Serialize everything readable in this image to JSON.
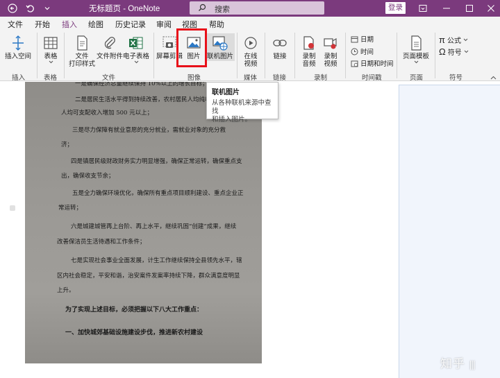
{
  "titlebar": {
    "title": "无标题页  -  OneNote",
    "search_placeholder": "搜索",
    "login": "登录",
    "icons": [
      "back-arrow-icon",
      "undo-icon",
      "dropdown-icon",
      "search-icon",
      "ribbon-display-icon",
      "minimize-icon",
      "maximize-icon",
      "close-icon"
    ]
  },
  "menu": {
    "tabs": [
      "文件",
      "开始",
      "插入",
      "绘图",
      "历史记录",
      "审阅",
      "视图",
      "帮助"
    ],
    "active": "插入"
  },
  "ribbon": {
    "insert_space": "插入空间",
    "table": "表格",
    "file_printout_1": "文件",
    "file_printout_2": "打印样式",
    "file_attachment": "文件附件",
    "spreadsheet": "电子表格",
    "screen_clipping": "屏幕剪辑",
    "picture": "图片",
    "online_picture": "联机图片",
    "online_video_1": "在线",
    "online_video_2": "视频",
    "link": "链接",
    "record_audio_1": "录制",
    "record_audio_2": "音频",
    "record_video_1": "录制",
    "record_video_2": "视频",
    "date": "日期",
    "time": "时间",
    "date_time": "日期和时间",
    "page_templates": "页面模板",
    "equation": "公式",
    "symbol": "符号",
    "groups": {
      "insert": "插入",
      "tables": "表格",
      "files": "文件",
      "images": "图像",
      "media": "媒体",
      "links": "链接",
      "recording": "录制",
      "timestamp": "时间戳",
      "pages": "页面",
      "symbols": "符号"
    }
  },
  "tooltip": {
    "title": "联机图片",
    "body_1": "从各种联机来源中查找",
    "body_2": "和插入图片。"
  },
  "document": {
    "lines": [
      "一是确保经济总量继续保持 10%以上的增长目标；",
      "二是居民生活水平得到持续改善，农村居民人均纯收入",
      "人均可支配收入增加 500 元以上；",
      "三是尽力保障有就业意愿的充分就业，需就业对象的充分救",
      "济；",
      "四是镇居民级财政财务实力明显增强，确保正常运转，确保重点支",
      "出，确保收支节余；",
      "五是全力确保环境优化，确保所有重点项目顺利建设、重点企业正",
      "常运转；",
      "六是城建城管再上台阶、再上水平，继续巩固“创建”成果，继续",
      "改善保洁员生活待遇和工作条件；",
      "七是实现社会事业全面发展，计生工作继续保持全县领先水平，辖",
      "区内社会稳定，平安和谐，治安案件发案率持续下降，群众满意度明显",
      "上升。",
      "为了实现上述目标，必须把握以下八大工作重点：",
      "一、加快城郊基础设施建设步伐，推进新农村建设"
    ]
  },
  "watermark": "知乎"
}
